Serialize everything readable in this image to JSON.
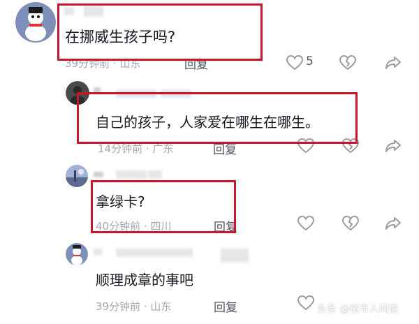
{
  "comments": [
    {
      "text": "在挪威生孩子吗?",
      "meta": "39分钟前 · 山东",
      "reply_label": "回复",
      "like_count": "5"
    },
    {
      "text": "自己的孩子，人家爱在哪生在哪生。",
      "meta": "14分钟前 · 广东",
      "reply_label": "回复"
    },
    {
      "text": "拿绿卡?",
      "meta": "40分钟前 · 四川",
      "reply_label": "回复"
    },
    {
      "text": "顺理成章的事吧",
      "meta": "39分钟前 · 山东",
      "reply_label": "回复"
    }
  ],
  "watermark": {
    "text": "头条 @裕丰人间说"
  },
  "colors": {
    "highlight": "#c9162b",
    "meta": "#a6a6ad",
    "icon": "#9a9ba1"
  },
  "icons": [
    "avatar-snowman",
    "avatar-dark",
    "avatar-landscape",
    "heart-icon",
    "broken-heart-icon",
    "share-icon"
  ]
}
